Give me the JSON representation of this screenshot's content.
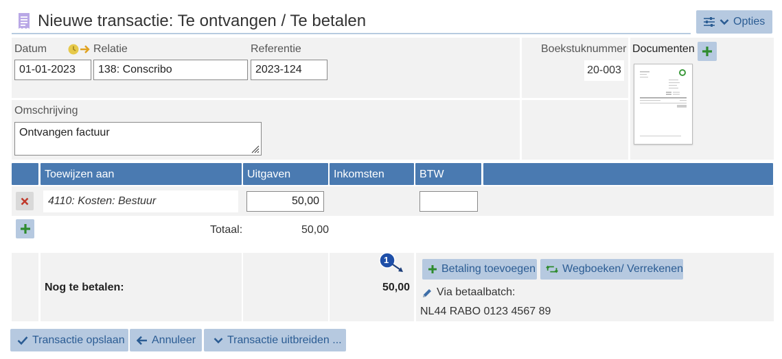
{
  "header": {
    "title": "Nieuwe transactie: Te ontvangen / Te betalen",
    "options_label": "Opties"
  },
  "form": {
    "date_label": "Datum",
    "date_value": "01-01-2023",
    "relation_label": "Relatie",
    "relation_value": "138: Conscribo",
    "reference_label": "Referentie",
    "reference_value": "2023-124",
    "booking_number_label": "Boekstuknummer",
    "booking_number_value": "20-003",
    "documents_label": "Documenten",
    "description_label": "Omschrijving",
    "description_value": "Ontvangen factuur"
  },
  "table": {
    "headers": [
      "Toewijzen aan",
      "Uitgaven",
      "Inkomsten",
      "BTW"
    ],
    "row": {
      "allocation": "4110: Kosten: Bestuur",
      "expense": "50,00",
      "income": "",
      "vat": ""
    },
    "total_label": "Totaal:",
    "total_value": "50,00"
  },
  "payment": {
    "label": "Nog te betalen:",
    "amount": "50,00",
    "badge": "1",
    "add_payment_label": "Betaling toevoegen",
    "settle_label": "Wegboeken/ Verrekenen",
    "via_label": "Via betaalbatch:",
    "iban": "NL44 RABO 0123 4567 89"
  },
  "footer": {
    "save_label": "Transactie opslaan",
    "cancel_label": "Annuleer",
    "expand_label": "Transactie uitbreiden ..."
  },
  "colors": {
    "accent": "#4a7ab1",
    "button_bg": "#b6c9e0",
    "button_text": "#2b5c93",
    "plus_green": "#2e8b2e",
    "delete_red": "#c0392b",
    "panel_bg": "#f2f2f2"
  },
  "icons": {
    "title": "receipt-icon",
    "options": "sliders-icon",
    "relation": "clock-arrow-icon",
    "add": "plus-icon",
    "delete": "close-icon",
    "settle": "retweet-icon",
    "via": "pencil-icon",
    "save": "check-icon",
    "cancel": "arrow-left-icon",
    "expand": "chevron-down-icon"
  }
}
